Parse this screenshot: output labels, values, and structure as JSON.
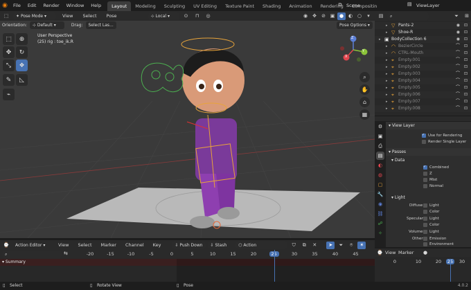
{
  "topbar": {
    "menus": [
      "File",
      "Edit",
      "Render",
      "Window",
      "Help"
    ],
    "workspaces": [
      "Layout",
      "Modeling",
      "Sculpting",
      "UV Editing",
      "Texture Paint",
      "Shading",
      "Animation",
      "Rendering",
      "Compositin"
    ],
    "active_workspace": "Layout",
    "scene": "Scene",
    "view_layer": "ViewLayer"
  },
  "viewport_header": {
    "mode": "Pose Mode",
    "menus": [
      "View",
      "Select",
      "Pose"
    ],
    "transform_orientation": "Local"
  },
  "viewport_subheader": {
    "orientation_label": "Orientation:",
    "orientation_value": "Default",
    "drag_label": "Drag:",
    "drag_value": "Select Las...",
    "pose_options": "Pose Options"
  },
  "viewport_info": {
    "perspective": "User Perspective",
    "object": "(25) rig : toe_ik.R"
  },
  "gizmo": {
    "z": "Z",
    "y": "Y",
    "x": "X"
  },
  "outliner": {
    "items": [
      {
        "label": "Pants-2",
        "indent": 2,
        "icon": "mesh-icon",
        "dim": false
      },
      {
        "label": "Shoe-R",
        "indent": 2,
        "icon": "mesh-icon",
        "dim": false
      },
      {
        "label": "BodyCollection 6",
        "indent": 1,
        "icon": "collection-icon",
        "dim": false
      },
      {
        "label": "BezierCircle",
        "indent": 2,
        "icon": "curve-icon",
        "dim": true
      },
      {
        "label": "CTRL-Mouth",
        "indent": 2,
        "icon": "curve-icon",
        "dim": true
      },
      {
        "label": "Empty.001",
        "indent": 2,
        "icon": "empty-icon",
        "dim": true
      },
      {
        "label": "Empty.002",
        "indent": 2,
        "icon": "empty-icon",
        "dim": true
      },
      {
        "label": "Empty.003",
        "indent": 2,
        "icon": "empty-icon",
        "dim": true
      },
      {
        "label": "Empty.004",
        "indent": 2,
        "icon": "empty-icon",
        "dim": true
      },
      {
        "label": "Empty.005",
        "indent": 2,
        "icon": "empty-icon",
        "dim": true
      },
      {
        "label": "Empty.006",
        "indent": 2,
        "icon": "empty-icon",
        "dim": true
      },
      {
        "label": "Empty.007",
        "indent": 2,
        "icon": "empty-icon",
        "dim": true
      },
      {
        "label": "Empty.008",
        "indent": 2,
        "icon": "empty-icon",
        "dim": true
      }
    ]
  },
  "properties": {
    "view_layer_title": "View Layer",
    "use_for_rendering": "Use for Rendering",
    "render_single_layer": "Render Single Layer",
    "passes_title": "Passes",
    "data_title": "Data",
    "data_items": [
      {
        "label": "Combined",
        "on": true
      },
      {
        "label": "Z",
        "on": false
      },
      {
        "label": "Mist",
        "on": false
      },
      {
        "label": "Normal",
        "on": false
      }
    ],
    "light_title": "Light",
    "light_rows": [
      {
        "group": "Diffuse",
        "items": [
          "Light",
          "Color"
        ]
      },
      {
        "group": "Specular",
        "items": [
          "Light",
          "Color"
        ]
      },
      {
        "group": "Volume",
        "items": [
          "Light"
        ]
      },
      {
        "group": "Other",
        "items": [
          "Emission",
          "Environment"
        ]
      }
    ]
  },
  "action_editor": {
    "editor_name": "Action Editor",
    "menus": [
      "View",
      "Select",
      "Marker",
      "Channel",
      "Key"
    ],
    "push_down": "Push Down",
    "stash": "Stash",
    "action_name": "Action",
    "frames": [
      "-20",
      "-15",
      "-10",
      "-5",
      "0",
      "5",
      "10",
      "15",
      "20",
      "25",
      "30",
      "35",
      "40",
      "45"
    ],
    "current_frame": "25",
    "summary": "Summary"
  },
  "timeline": {
    "view": "View",
    "marker": "Marker",
    "frames": [
      "0",
      "10",
      "20",
      "25",
      "30"
    ],
    "current_frame": "25"
  },
  "statusbar": {
    "left": "Select",
    "middle": "Rotate View",
    "right": "Pose",
    "version": "4.0.2"
  },
  "colors": {
    "accent": "#4772b3",
    "active_frame": "#4772b3",
    "armature_orange": "#e8a43a",
    "mesh_purple": "#8e3fb0"
  }
}
